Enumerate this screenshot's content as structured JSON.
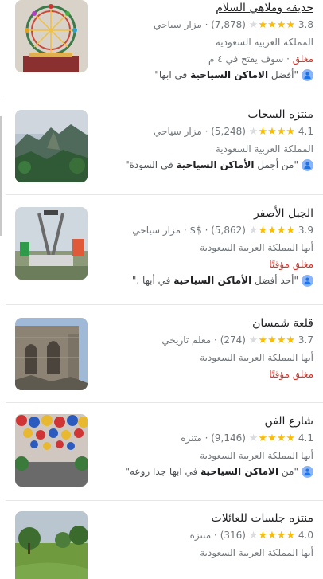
{
  "places": [
    {
      "name": "حديقة وملاهي السلام",
      "rating": "3.8",
      "reviews": "(7,878)",
      "category": "· مزار سياحي",
      "location": "المملكة العربية السعودية",
      "status_closed": "مغلق",
      "status_note": " · سوف يفتح في ٤ م",
      "review_prefix": "\"أفضل ",
      "review_bold": "الاماكن السياحية",
      "review_suffix": " في ابها\"",
      "stars_full": 4
    },
    {
      "name": "منتزه السحاب",
      "rating": "4.1",
      "reviews": "(5,248)",
      "category": "· مزار سياحي",
      "location": "المملكة العربية السعودية",
      "review_prefix": "\"من أجمل ",
      "review_bold": "الأماكن السياحية",
      "review_suffix": " في السودة\"",
      "stars_full": 4
    },
    {
      "name": "الجبل الأصفر",
      "rating": "3.9",
      "reviews": "(5,862)",
      "price": "· $$",
      "category": "· مزار سياحي",
      "location": "أبها المملكة العربية السعودية",
      "status_closed": "مغلق مؤقتًا",
      "review_prefix": "\"أحد أفضل ",
      "review_bold": "الأماكن السياحية",
      "review_suffix": " في أبها .\"",
      "stars_full": 4
    },
    {
      "name": "قلعة شمسان",
      "rating": "3.7",
      "reviews": "(274)",
      "category": "· معلم تاريخي",
      "location": "أبها المملكة العربية السعودية",
      "status_closed": "مغلق مؤقتًا",
      "stars_full": 4
    },
    {
      "name": "شارع الفن",
      "rating": "4.1",
      "reviews": "(9,146)",
      "category": "· متنزه",
      "location": "أبها المملكة العربية السعودية",
      "review_prefix": "\"من ",
      "review_bold": "الاماكن السياحية",
      "review_suffix": " في ابها جدا روعه\"",
      "stars_full": 4
    },
    {
      "name": "منتزه جلسات للعائلات",
      "rating": "4.0",
      "reviews": "(316)",
      "category": "· متنزه",
      "location": "أبها المملكة العربية السعودية",
      "stars_full": 4
    }
  ],
  "colors": {
    "star": "#fbbc04",
    "closed": "#d93025",
    "avatar": "#8ab4f8"
  },
  "icons": {
    "review_avatar": "person-icon",
    "rating_star": "star-icon"
  }
}
